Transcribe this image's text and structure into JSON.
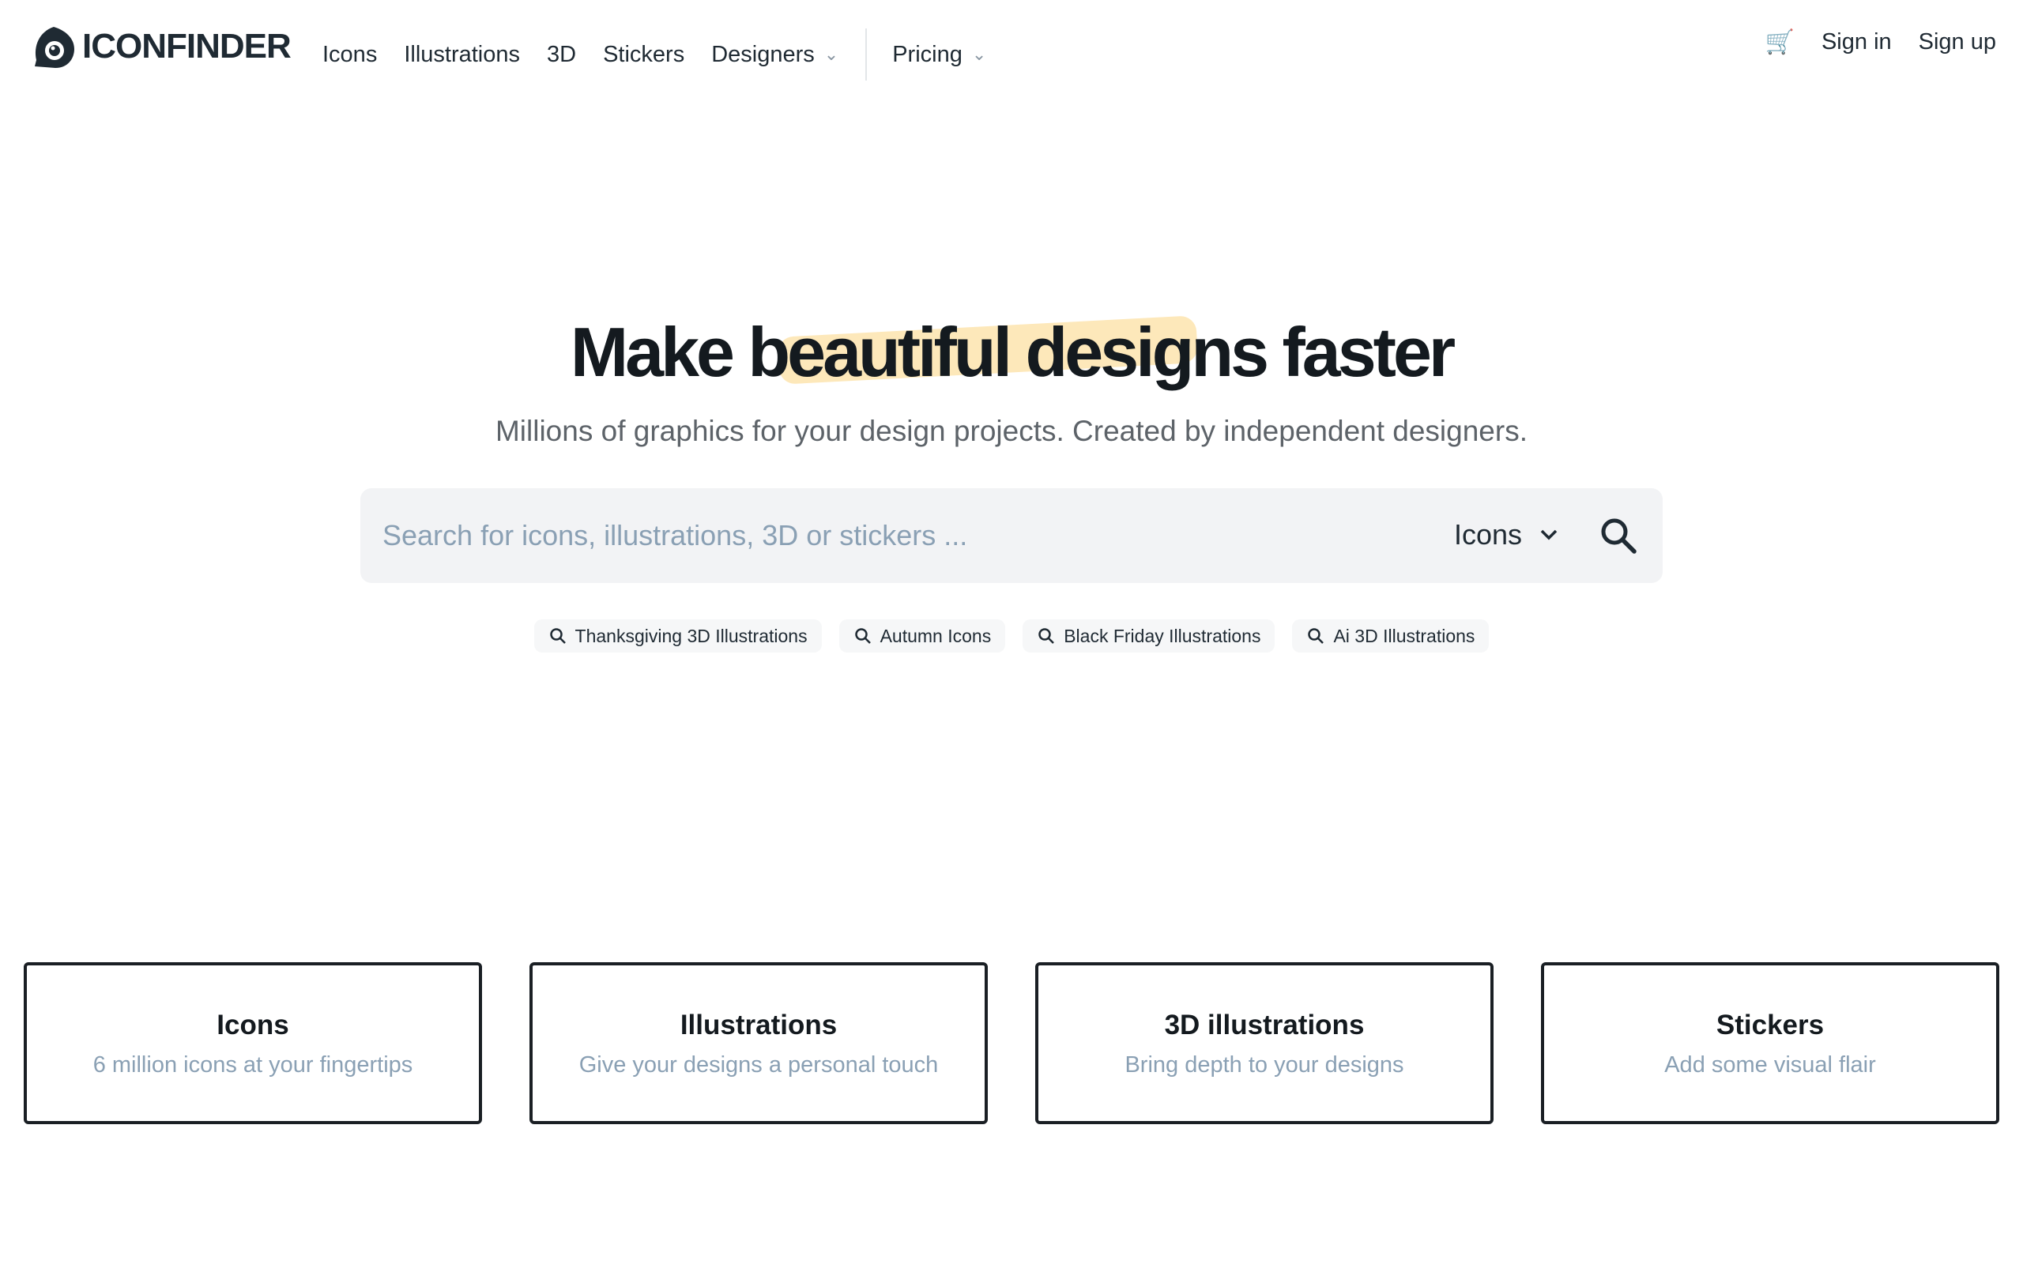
{
  "nav": {
    "logo": "ICONFINDER",
    "links": [
      "Icons",
      "Illustrations",
      "3D",
      "Stickers",
      "Designers"
    ],
    "pricing": "Pricing",
    "sign_in": "Sign in",
    "sign_up": "Sign up"
  },
  "hero": {
    "title": "Make beautiful designs faster",
    "subtitle": "Millions of graphics for your design projects. Created by independent designers."
  },
  "search": {
    "placeholder": "Search for icons, illustrations, 3D or stickers ...",
    "type": "Icons"
  },
  "chips": [
    "Thanksgiving 3D Illustrations",
    "Autumn Icons",
    "Black Friday Illustrations",
    "Ai 3D Illustrations"
  ],
  "cards": [
    {
      "title": "Icons",
      "desc": "6 million icons at your fingertips"
    },
    {
      "title": "Illustrations",
      "desc": "Give your designs a personal touch"
    },
    {
      "title": "3D illustrations",
      "desc": "Bring depth to your designs"
    },
    {
      "title": "Stickers",
      "desc": "Add some visual flair"
    }
  ],
  "colors": {
    "highlight": "#fde4ae",
    "search_bg": "#f2f3f5",
    "muted": "#8aa0b4"
  }
}
